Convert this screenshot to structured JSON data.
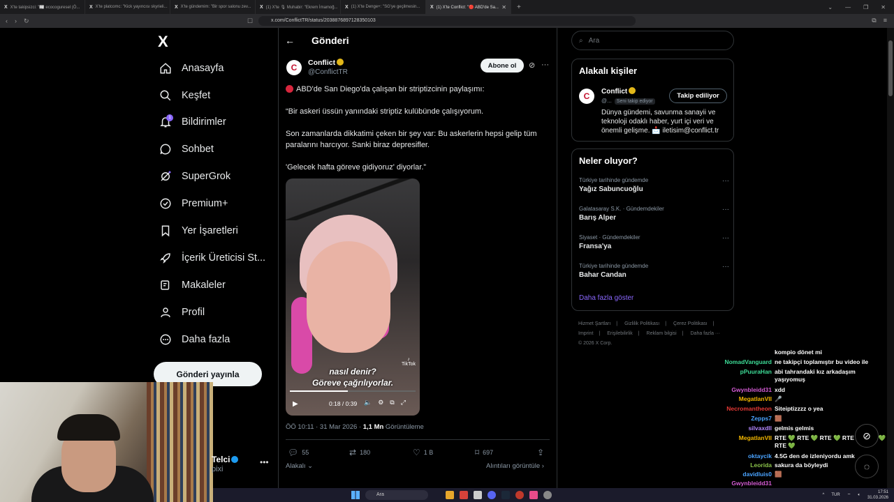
{
  "browser": {
    "tabs": [
      {
        "label": "X'te takipsizci: \"📰 ecocoguresel (Ö...",
        "active": false
      },
      {
        "label": "X'te platcomc: \"Kick yayıncısı skyrieli...",
        "active": false
      },
      {
        "label": "X'te gündemim: \"Bir spor salonu zev...",
        "active": false
      },
      {
        "label": "(1) X'te 🎙 Muhabir: \"Ekrem İmamoğ...",
        "active": false
      },
      {
        "label": "(1) X'te Denge+: \"SG'ye geçilmesin...",
        "active": false
      },
      {
        "label": "(1) X'te Conflict: \"🔴 ABD'de Sa...",
        "active": true
      }
    ],
    "url": "x.com/ConflictTR/status/2038876897128350103"
  },
  "nav": {
    "logo": "X",
    "items": [
      {
        "label": "Anasayfa",
        "icon": "home-icon"
      },
      {
        "label": "Keşfet",
        "icon": "search-icon"
      },
      {
        "label": "Bildirimler",
        "icon": "bell-icon",
        "badge": "1"
      },
      {
        "label": "Sohbet",
        "icon": "chat-icon"
      },
      {
        "label": "SuperGrok",
        "icon": "grok-icon"
      },
      {
        "label": "Premium+",
        "icon": "premium-icon"
      },
      {
        "label": "Yer İşaretleri",
        "icon": "bookmark-icon"
      },
      {
        "label": "İçerik Üreticisi St...",
        "icon": "rocket-icon"
      },
      {
        "label": "Makaleler",
        "icon": "article-icon"
      },
      {
        "label": "Profil",
        "icon": "person-icon"
      },
      {
        "label": "Daha fazla",
        "icon": "more-circle-icon"
      }
    ],
    "post_button": "Gönderi yayınla",
    "profile_name": "Telci",
    "profile_handle": "pixi"
  },
  "post": {
    "page_title": "Gönderi",
    "author_name": "Conflict",
    "author_handle": "@ConflictTR",
    "subscribe_label": "Abone ol",
    "text1": "ABD'de San Diego'da çalışan bir striptizcinin paylaşımı:",
    "text2": "“Bir askeri üssün yanındaki striptiz kulübünde çalışıyorum.",
    "text3": "Son zamanlarda dikkatimi çeken bir şey var: Bu askerlerin hepsi gelip tüm paralarını harcıyor. Sanki biraz depresifler.",
    "text4": "'Gelecek hafta göreve gidiyoruz' diyorlar.”",
    "video": {
      "caption1": "nasıl denir?",
      "caption2": "Göreve çağrılıyorlar.",
      "tiktok": "TikTok",
      "time": "0:18 / 0:39",
      "progress": 0.46
    },
    "time": "ÖÖ 10:11 · 31 Mar 2026 · ",
    "views_count": "1,1 Mn",
    "views_label": " Görüntüleme",
    "replies": "55",
    "reposts": "180",
    "likes": "1 B",
    "bookmarks": "697",
    "related_label": "Alakalı",
    "quotes_label": "Alıntıları görüntüle"
  },
  "sidebar": {
    "search_placeholder": "Ara",
    "related_title": "Alakalı kişiler",
    "related_name": "Conflict",
    "related_handle": "@...",
    "follows_you": "Seni takip ediyor",
    "follow_button": "Takip ediliyor",
    "related_bio": "Dünya gündemi, savunma sanayii ve teknoloji odaklı haber, yurt içi veri ve önemli gelişme. 📩 iletisim@conflict.tr",
    "trends_title": "Neler oluyor?",
    "trends": [
      {
        "context": "Türkiye tarihinde gündemde",
        "name": "Yağız Sabuncuoğlu"
      },
      {
        "context": "Galatasaray S.K. · Gündemdekiler",
        "name": "Barış Alper"
      },
      {
        "context": "Siyaset · Gündemdekiler",
        "name": "Fransa'ya"
      },
      {
        "context": "Türkiye tarihinde gündemde",
        "name": "Bahar Candan"
      }
    ],
    "show_more": "Daha fazla göster",
    "footer": [
      "Hizmet Şartları",
      "|",
      "Gizlilik Politikası",
      "|",
      "Çerez Politikası",
      "|",
      "Imprint",
      "|",
      "Erişilebilirlik",
      "|",
      "Reklam bilgisi",
      "|",
      "Daha fazla ···",
      "© 2026 X Corp."
    ]
  },
  "chat": {
    "messages": [
      {
        "user": "",
        "text": "kompio dönet mi",
        "color": "#ffffff"
      },
      {
        "user": "NomadVanguard",
        "text": "ne takipçi toplamıştır bu video ile",
        "color": "#3ddc97"
      },
      {
        "user": "pPuuraHan",
        "text": "abi tahrandaki kız arkadaşım yaşıyomuş",
        "color": "#3ddc97"
      },
      {
        "user": "Gwynbleidd31",
        "text": "xdd",
        "color": "#d45bd4"
      },
      {
        "user": "MegatlanVII",
        "text": "🎤",
        "color": "#f5b800"
      },
      {
        "user": "Necromantheon",
        "text": "Siteiptizzzz o yea",
        "color": "#e53935"
      },
      {
        "user": "Zepps7",
        "text": "🟫",
        "color": "#4aa3ff"
      },
      {
        "user": "silvaxdll",
        "text": "gelmis gelmis",
        "color": "#b388ff"
      },
      {
        "user": "MegatlanVII",
        "text": "RTE 💚 RTE 💚 RTE 💚 RTE 💚 RTE 💚 RTE 💚",
        "color": "#f5b800"
      },
      {
        "user": "oktaycik",
        "text": "4.5G den de izleniyordu amk",
        "color": "#4aa3ff"
      },
      {
        "user": "Leorida",
        "text": "sakura da böyleydi",
        "color": "#8bc34a"
      },
      {
        "user": "davidluis0",
        "text": "🟫",
        "color": "#4aa3ff"
      },
      {
        "user": "Gwynbleidd31",
        "text": "",
        "color": "#d45bd4"
      }
    ]
  },
  "taskbar": {
    "search": "Ara",
    "lang": "TUR",
    "time": "17:51",
    "date": "31.03.2026"
  }
}
